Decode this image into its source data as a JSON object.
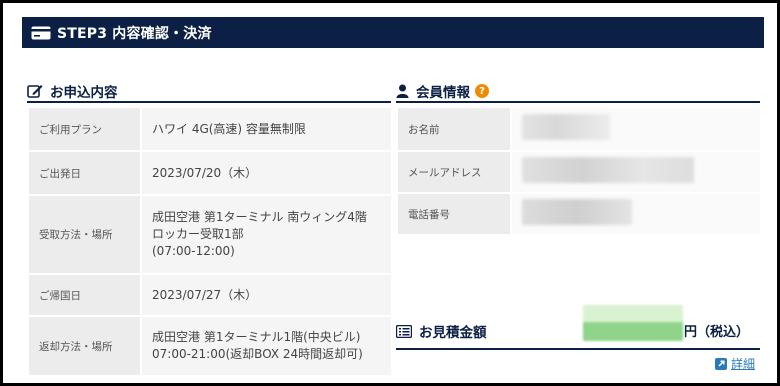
{
  "step_header": {
    "title": "STEP3 内容確認・決済",
    "icon": "credit-card-icon"
  },
  "application": {
    "title": "お申込内容",
    "icon": "edit-icon",
    "rows": [
      {
        "label": "ご利用プラン",
        "lines": [
          "ハワイ 4G(高速) 容量無制限"
        ]
      },
      {
        "label": "ご出発日",
        "lines": [
          "2023/07/20（木）"
        ]
      },
      {
        "label": "受取方法・場所",
        "lines": [
          "成田空港 第1ターミナル 南ウィング4階",
          "ロッカー受取1部",
          "(07:00-12:00)"
        ]
      },
      {
        "label": "ご帰国日",
        "lines": [
          "2023/07/27（木）"
        ]
      },
      {
        "label": "返却方法・場所",
        "lines": [
          "成田空港 第1ターミナル1階(中央ビル)",
          "07:00-21:00(返却BOX 24時間返却可)"
        ]
      }
    ]
  },
  "member": {
    "title": "会員情報",
    "icon": "user-icon",
    "help_icon": "question-icon",
    "help_glyph": "?",
    "rows": [
      {
        "label": "お名前"
      },
      {
        "label": "メールアドレス"
      },
      {
        "label": "電話番号"
      }
    ]
  },
  "estimate": {
    "title": "お見積金額",
    "icon": "list-icon",
    "suffix": "円（税込）",
    "detail_label": "詳細",
    "detail_icon": "external-link-icon"
  },
  "colors": {
    "navy": "#0c1f44",
    "accent_orange": "#f08a00",
    "link": "#2a7ab8",
    "blur_green": "#8fd48a"
  }
}
